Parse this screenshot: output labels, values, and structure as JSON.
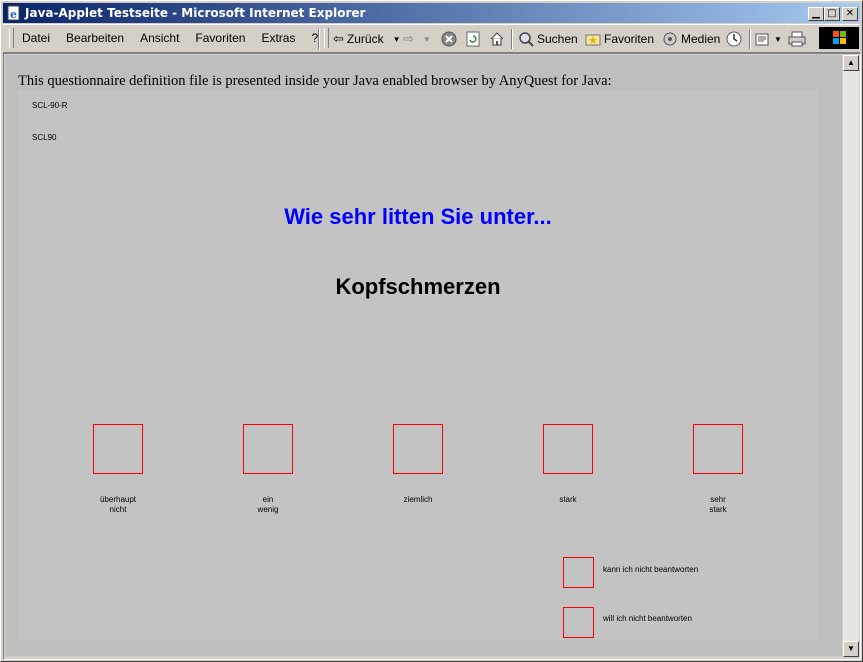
{
  "window": {
    "title": "Java-Applet Testseite - Microsoft Internet Explorer"
  },
  "menu": [
    "Datei",
    "Bearbeiten",
    "Ansicht",
    "Favoriten",
    "Extras",
    "?"
  ],
  "toolbar": {
    "back_label": "Zurück",
    "search_label": "Suchen",
    "favorites_label": "Favoriten",
    "media_label": "Medien"
  },
  "page": {
    "intro": "This questionnaire definition file is presented inside your Java enabled browser by AnyQuest for Java:"
  },
  "applet": {
    "label1": "SCL-90-R",
    "label2": "SCL90",
    "question": "Wie sehr litten Sie unter...",
    "item": "Kopfschmerzen",
    "options": [
      "überhaupt\nnicht",
      "ein\nwenig",
      "ziemlich",
      "stark",
      "sehr\nstark"
    ],
    "extra_options": [
      "kann ich nicht beantworten",
      "will ich nicht beantworten"
    ]
  },
  "colors": {
    "heading": "#0000ff",
    "box_border": "#ff0000",
    "titlebar_start": "#0a246a",
    "titlebar_end": "#a6caf0"
  },
  "icons": [
    "ie-page-icon",
    "minimize-icon",
    "maximize-icon",
    "close-icon",
    "back-arrow-icon",
    "forward-arrow-icon",
    "stop-icon",
    "refresh-icon",
    "home-icon",
    "search-icon",
    "favorites-icon",
    "media-icon",
    "history-icon",
    "mail-icon",
    "print-icon",
    "windows-logo-icon"
  ]
}
